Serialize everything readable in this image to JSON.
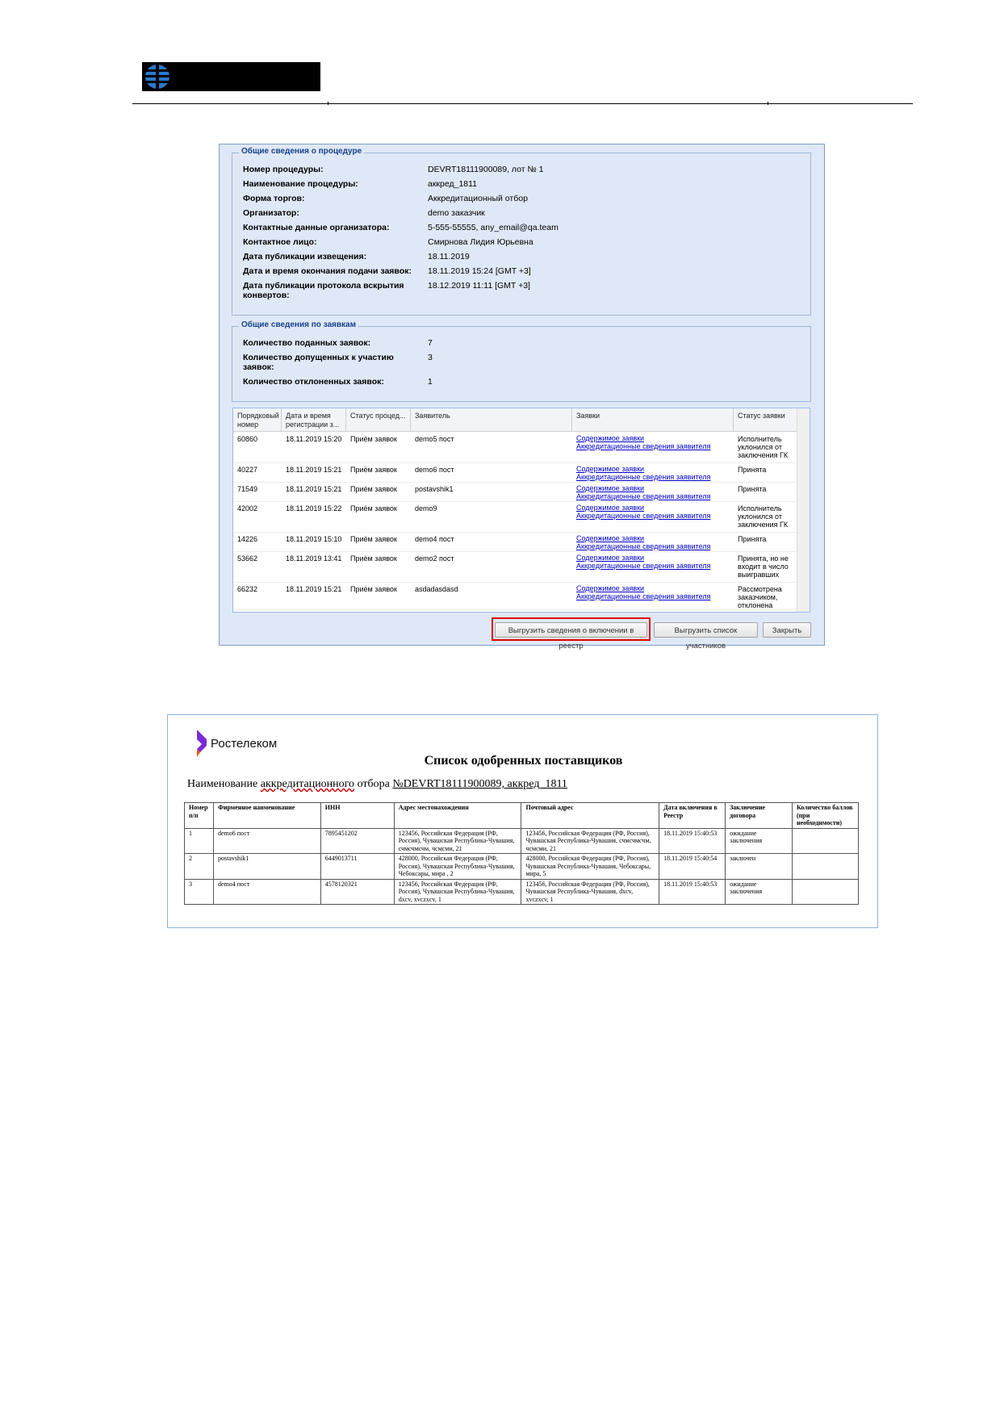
{
  "logo": {
    "icon": "company-emblem-icon"
  },
  "dialog": {
    "section1_title": "Общие сведения о процедуре",
    "procedure": [
      {
        "label": "Номер процедуры:",
        "value": "DEVRT18111900089, лот № 1"
      },
      {
        "label": "Наименование процедуры:",
        "value": "аккред_1811"
      },
      {
        "label": "Форма торгов:",
        "value": "Аккредитационный отбор"
      },
      {
        "label": "Организатор:",
        "value": "demo заказчик"
      },
      {
        "label": "Контактные данные организатора:",
        "value": "5-555-55555, any_email@qa.team"
      },
      {
        "label": "Контактное лицо:",
        "value": "Смирнова Лидия Юрьевна"
      },
      {
        "label": "Дата публикации извещения:",
        "value": "18.11.2019"
      },
      {
        "label": "Дата и время окончания подачи заявок:",
        "value": "18.11.2019 15:24 [GMT +3]"
      },
      {
        "label": "Дата публикации протокола вскрытия конвертов:",
        "value": "18.12.2019 11:11 [GMT +3]"
      }
    ],
    "section2_title": "Общие сведения по заявкам",
    "applications": [
      {
        "label": "Количество поданных заявок:",
        "value": "7"
      },
      {
        "label": "Количество допущенных к участию заявок:",
        "value": "3"
      },
      {
        "label": "Количество отклоненных заявок:",
        "value": "1"
      }
    ],
    "grid": {
      "headers": [
        "Порядковый номер",
        "Дата и время регистрации з...",
        "Статус процед...",
        "Заявитель",
        "Заявки",
        "Статус заявки"
      ],
      "link1": "Содержимое заявки",
      "link2": "Аккредитационные сведения заявителя",
      "rows": [
        {
          "num": "60860",
          "date": "18.11.2019 15:20",
          "status": "Приём заявок",
          "applicant": "demo5 пост",
          "app_status": "Исполнитель уклонился от заключения ГК"
        },
        {
          "num": "40227",
          "date": "18.11.2019 15:21",
          "status": "Приём заявок",
          "applicant": "demo6 пост",
          "app_status": "Принята"
        },
        {
          "num": "71549",
          "date": "18.11.2019 15:21",
          "status": "Приём заявок",
          "applicant": "postavshik1",
          "app_status": "Принята"
        },
        {
          "num": "42002",
          "date": "18.11.2019 15:22",
          "status": "Приём заявок",
          "applicant": "demo9",
          "app_status": "Исполнитель уклонился от заключения ГК"
        },
        {
          "num": "14226",
          "date": "18.11.2019 15:10",
          "status": "Приём заявок",
          "applicant": "demo4 пост",
          "app_status": "Принята"
        },
        {
          "num": "53662",
          "date": "18.11.2019 13:41",
          "status": "Приём заявок",
          "applicant": "demo2 пост",
          "app_status": "Принята, но не входит в число выигравших"
        },
        {
          "num": "66232",
          "date": "18.11.2019 15:21",
          "status": "Приём заявок",
          "applicant": "asdadasdasd",
          "app_status": "Рассмотрена заказчиком, отклонена"
        }
      ]
    },
    "buttons": {
      "export_registry": "Выгрузить сведения о включении в реестр",
      "export_participants": "Выгрузить список участников",
      "close": "Закрыть"
    },
    "highlight_color": "#e00000"
  },
  "report": {
    "logo_text": "Ростелеком",
    "logo_color": "#7b2ad8",
    "title": "Список одобренных поставщиков",
    "subtitle_prefix": "Наименование ",
    "subtitle_link": "аккредитационного",
    "subtitle_mid": " отбора ",
    "subtitle_number": "№DEVRT18111900089, аккред_1811",
    "headers": [
      "Номер п/п",
      "Фирменное наименование",
      "ИНН",
      "Адрес местонахождения",
      "Почтовый адрес",
      "Дата включения в Реестр",
      "Заключение договора",
      "Количество баллов (при необходимости)"
    ],
    "rows": [
      [
        "1",
        "demo6 пост",
        "7895451202",
        "123456, Российская Федерация (РФ, Россия), Чувашская Республика-Чувашия, счмсчмсчм, чсмсми, 21",
        "123456, Российская Федерация (РФ, Россия), Чувашская Республика-Чувашия, счмсчмсчм, чсмсми, 21",
        "18.11.2019 15:40:53",
        "ожидание заключения",
        ""
      ],
      [
        "2",
        "postavshik1",
        "6449013711",
        "428000, Российская Федерация (РФ, Россия), Чувашская Республика-Чувашия, Чебоксары, мира , 2",
        "428000, Российская Федерация (РФ, Россия), Чувашская Республика-Чувашия, Чебоксары, мира, 5",
        "18.11.2019 15:40:54",
        "заключен",
        ""
      ],
      [
        "3",
        "demo4 пост",
        "4578120321",
        "123456, Российская Федерация (РФ, Россия), Чувашская Республика-Чувашия, dxcv, xvczxcv, 1",
        "123456, Российская Федерация (РФ, Россия), Чувашская Республика-Чувашия, dxcv, xvczxcv, 1",
        "18.11.2019 15:40:53",
        "ожидание заключения",
        ""
      ]
    ]
  }
}
